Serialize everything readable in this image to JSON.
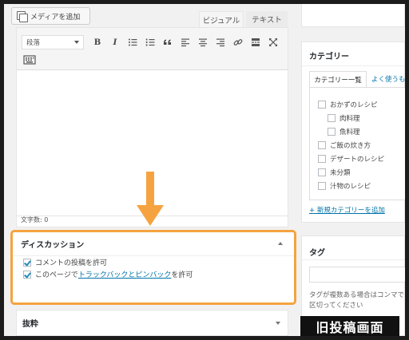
{
  "editor": {
    "media_button": "メディアを追加",
    "tab_visual": "ビジュアル",
    "tab_text": "テキスト",
    "format_select": "段落",
    "toolbar_icons": [
      "bold-icon",
      "italic-icon",
      "bullet-list-icon",
      "numbered-list-icon",
      "blockquote-icon",
      "align-left-icon",
      "align-center-icon",
      "align-right-icon",
      "link-icon",
      "read-more-icon",
      "fullscreen-icon",
      "toolbar-toggle-icon"
    ],
    "bold_glyph": "B",
    "italic_glyph": "I",
    "word_count": "文字数: 0"
  },
  "discussion": {
    "title": "ディスカッション",
    "allow_comments": "コメントの投稿を許可",
    "allow_pings_prefix": "このページで",
    "allow_pings_link": "トラックバックとピンバック",
    "allow_pings_suffix": "を許可",
    "allow_comments_checked": true,
    "allow_pings_checked": true
  },
  "excerpt": {
    "title": "抜粋"
  },
  "categories": {
    "title": "カテゴリー",
    "tab_all": "カテゴリー一覧",
    "tab_popular": "よく使うも",
    "items": [
      {
        "label": "おかずのレシピ",
        "checked": false
      },
      {
        "label": "肉料理",
        "checked": false
      },
      {
        "label": "魚料理",
        "checked": false
      },
      {
        "label": "ご飯の炊き方",
        "checked": false
      },
      {
        "label": "デザートのレシピ",
        "checked": false
      },
      {
        "label": "未分類",
        "checked": false
      },
      {
        "label": "汁物のレシピ",
        "checked": false
      }
    ],
    "add_new": "+ 新規カテゴリーを追加"
  },
  "tags": {
    "title": "タグ",
    "input_value": "",
    "note": "タグが複数ある場合はコンマで区切ってください"
  },
  "annotation": {
    "caption": "旧投稿画面",
    "arrow_color": "#f5a340",
    "highlight_color": "#f5a340"
  },
  "colors": {
    "accent_link": "#0073aa",
    "checkbox_check": "#1e8cbe",
    "background": "#f1f1f1"
  }
}
